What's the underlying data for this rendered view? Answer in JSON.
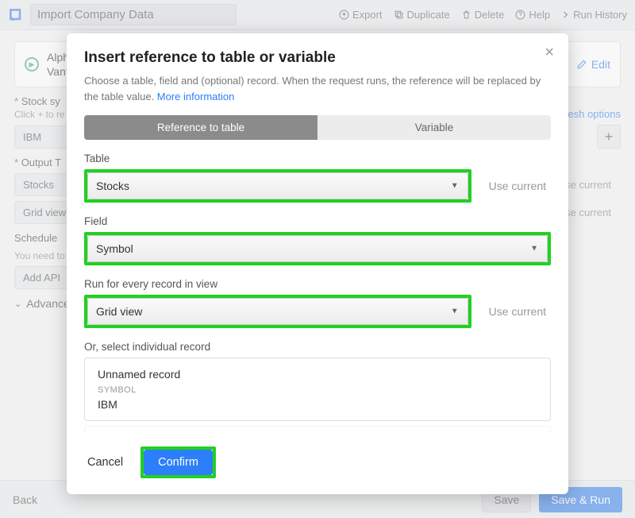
{
  "topbar": {
    "title": "Import Company Data",
    "export": "Export",
    "duplicate": "Duplicate",
    "delete": "Delete",
    "help": "Help",
    "run_history": "Run History"
  },
  "bg": {
    "integration_line1": "Alpha",
    "integration_line2": "Vanta",
    "edit": "Edit",
    "section1_label": "Stock sy",
    "section1_sub": "Click + to re",
    "section1_pill": "IBM",
    "refresh_options": "Refresh options",
    "section2_label": "Output T",
    "section2_pill1": "Stocks",
    "section2_pill2": "Grid view",
    "use_current": "Use current",
    "schedule_label": "Schedule",
    "schedule_sub": "You need to",
    "add_api": "Add API",
    "advanced": "Advanced"
  },
  "footer": {
    "back": "Back",
    "save": "Save",
    "save_run": "Save & Run"
  },
  "modal": {
    "title": "Insert reference to table or variable",
    "desc_pre": "Choose a table, field and (optional) record. When the request runs, the reference will be replaced by the table value. ",
    "desc_link": "More information",
    "tab_table": "Reference to table",
    "tab_variable": "Variable",
    "table_label": "Table",
    "table_value": "Stocks",
    "use_current": "Use current",
    "field_label": "Field",
    "field_value": "Symbol",
    "view_label": "Run for every record in view",
    "view_value": "Grid view",
    "individual_label": "Or, select individual record",
    "record_title": "Unnamed record",
    "record_field": "SYMBOL",
    "record_value": "IBM",
    "cancel": "Cancel",
    "confirm": "Confirm"
  }
}
